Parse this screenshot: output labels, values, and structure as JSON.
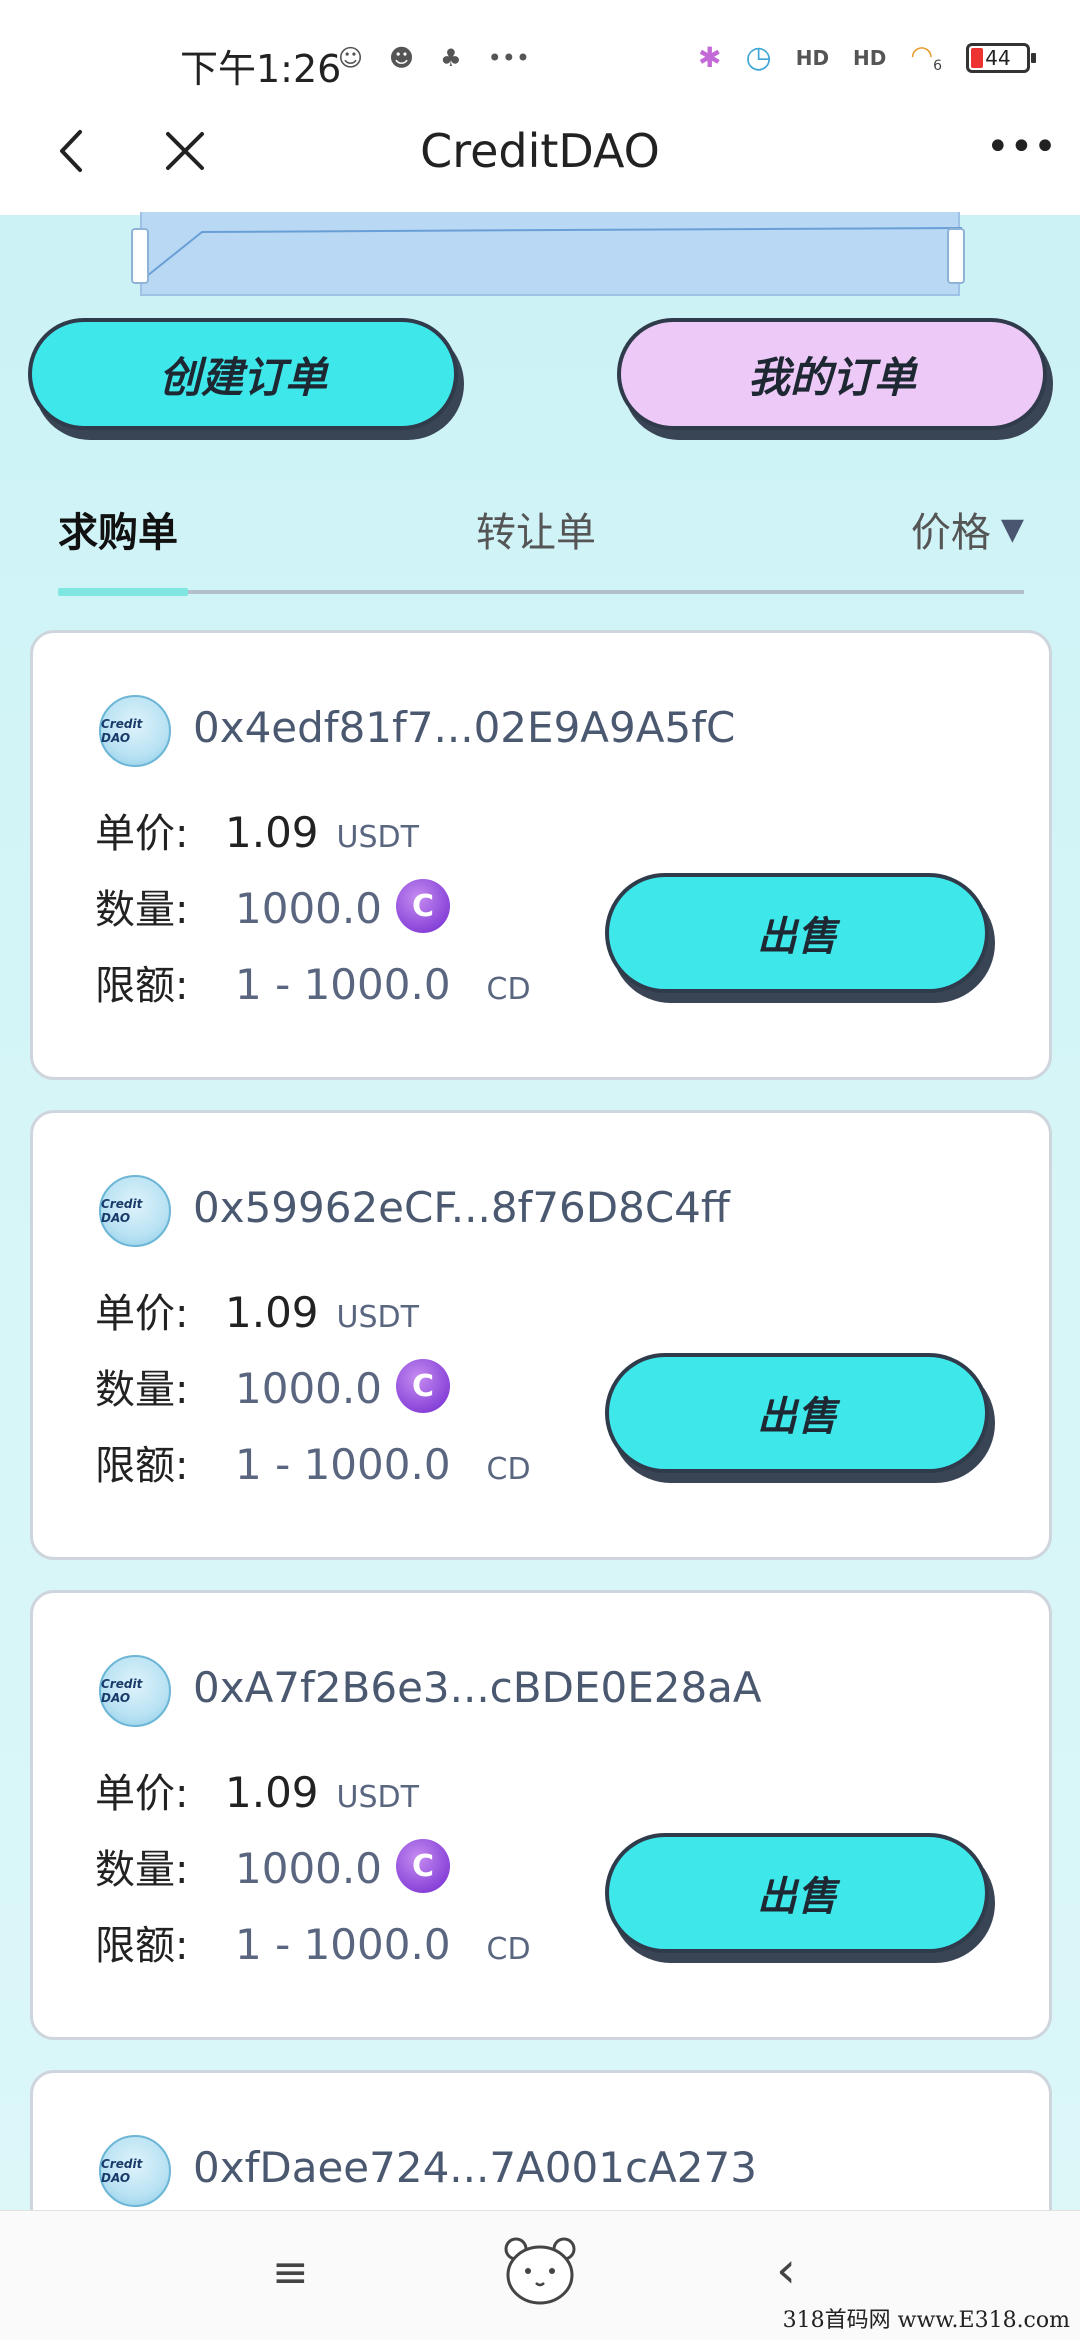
{
  "status_bar": {
    "time": "下午1:26",
    "left_icons": [
      "app-icon-1",
      "app-icon-2",
      "app-icon-3",
      "more-dots"
    ],
    "signal_1": "HD",
    "signal_2": "HD",
    "wifi_label": "6",
    "battery": "44"
  },
  "nav": {
    "title": "CreditDAO",
    "more": "•••"
  },
  "actions": {
    "create_order": "创建订单",
    "my_orders": "我的订单"
  },
  "tabs": {
    "buy": "求购单",
    "transfer": "转让单",
    "price": "价格",
    "price_sort_icon": "▼"
  },
  "logo_text": "Credit DAO",
  "labels": {
    "unit_price": "单价:",
    "quantity": "数量:",
    "limit": "限额:",
    "sell": "出售"
  },
  "orders": [
    {
      "address": "0x4edf81f7...02E9A9A5fC",
      "price": "1.09",
      "price_unit": "USDT",
      "quantity": "1000.0",
      "limit": "1 - 1000.0",
      "limit_unit": "CD"
    },
    {
      "address": "0x59962eCF...8f76D8C4ff",
      "price": "1.09",
      "price_unit": "USDT",
      "quantity": "1000.0",
      "limit": "1 - 1000.0",
      "limit_unit": "CD"
    },
    {
      "address": "0xA7f2B6e3...cBDE0E28aA",
      "price": "1.09",
      "price_unit": "USDT",
      "quantity": "1000.0",
      "limit": "1 - 1000.0",
      "limit_unit": "CD"
    },
    {
      "address": "0xfDaee724...7A001cA273"
    }
  ],
  "token_icon_glyph": "C",
  "bottom_bar": {
    "menu_icon": "≡",
    "back_icon": "‹"
  },
  "watermark": "318首码网 www.E318.com",
  "colors": {
    "primary_button": "#3ee7ea",
    "secondary_button": "#edc9f7",
    "token_icon": "#8a45d9"
  }
}
